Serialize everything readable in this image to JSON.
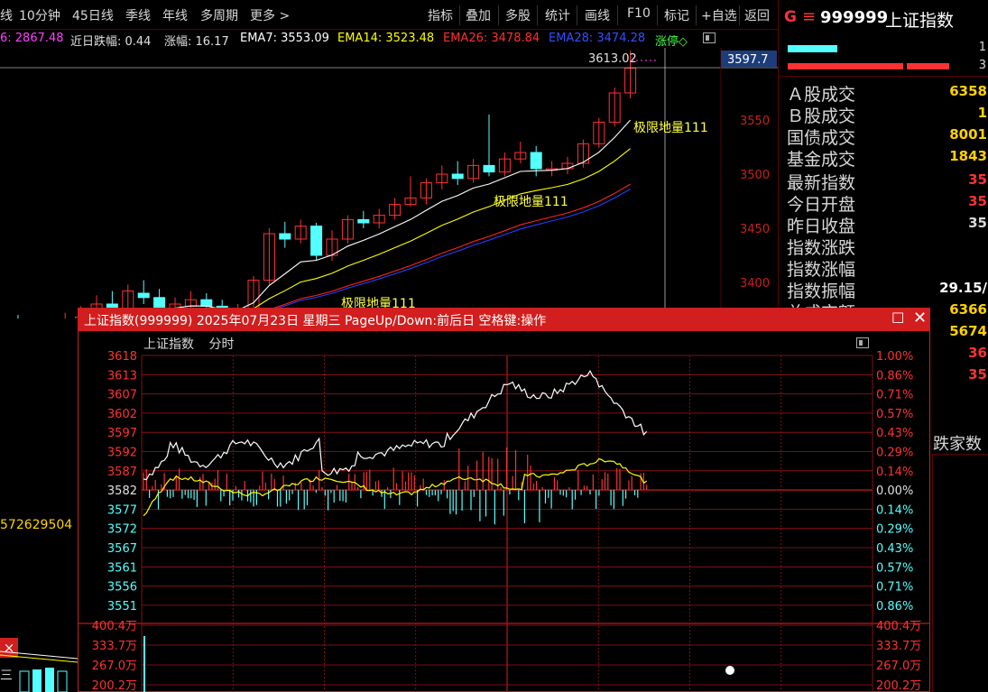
{
  "toolbar": {
    "left_items": [
      "线",
      "10分钟",
      "45日线",
      "季线",
      "年线",
      "多周期",
      "更多 >"
    ],
    "right_items": [
      "指标",
      "叠加",
      "多股",
      "统计",
      "画线",
      "F10",
      "标记",
      "+自选",
      "返回"
    ]
  },
  "indicator_line": {
    "prefix": "6: 2867.48",
    "near_drop_label": "近日跌幅: 0.44",
    "rise_label": "涨幅: 16.17",
    "ema7": "EMA7: 3553.09",
    "ema14": "EMA14: 3523.48",
    "ema26": "EMA26: 3478.84",
    "ema28": "EMA28: 3474.28",
    "limit_up": "涨停◇"
  },
  "kline": {
    "high_label": "3613.02",
    "price_tag": "3597.7",
    "axis_labels": [
      "3550",
      "3500",
      "3450",
      "3400"
    ],
    "annotations": [
      "极限地量111",
      "极限地量111",
      "极限地量111"
    ],
    "colors": {
      "up": "#ff3232",
      "down": "#54ffff",
      "ema7": "#ffffff",
      "ema14": "#ffff00",
      "ema26": "#ff2020",
      "ema28": "#2040ff"
    }
  },
  "right_panel": {
    "logo_text": "G",
    "menu_icon": "≡",
    "code": "999999",
    "name": "上证指数",
    "bar_values": [
      "1",
      "3"
    ],
    "rows": [
      {
        "label": "Ａ股成交",
        "value": "6358"
      },
      {
        "label": "Ｂ股成交",
        "value": "1"
      },
      {
        "label": "国债成交",
        "value": "8001"
      },
      {
        "label": "基金成交",
        "value": "1843"
      },
      {
        "label": "最新指数",
        "value": "35"
      },
      {
        "label": "今日开盘",
        "value": "35"
      },
      {
        "label": "昨日收盘",
        "value": "35"
      },
      {
        "label": "指数涨跌",
        "value": ""
      },
      {
        "label": "指数涨幅",
        "value": ""
      },
      {
        "label": "指数振幅",
        "value": "29.15/"
      },
      {
        "label": "总成交额",
        "value": "6366"
      },
      {
        "label": "",
        "value": "5674"
      },
      {
        "label": "",
        "value": "36"
      },
      {
        "label": "",
        "value": "35"
      }
    ],
    "side_legend": "跌家数"
  },
  "left_fragments": {
    "volume_label": "572629504",
    "close_glyph": "×",
    "char_fragment": "三"
  },
  "popup": {
    "title": "上证指数(999999) 2025年07月23日 星期三 PageUp/Down:前后日 空格键:操作",
    "tab_name": "上证指数",
    "tab_period": "分时",
    "price_ticks": [
      "3618",
      "3613",
      "3607",
      "3602",
      "3597",
      "3592",
      "3587",
      "3582",
      "3577",
      "3572",
      "3567",
      "3561",
      "3556",
      "3551"
    ],
    "pct_ticks": [
      "1.00%",
      "0.86%",
      "0.71%",
      "0.57%",
      "0.43%",
      "0.29%",
      "0.14%",
      "0.00%",
      "0.14%",
      "0.29%",
      "0.43%",
      "0.57%",
      "0.71%",
      "0.86%"
    ],
    "volume_ticks": [
      "400.4万",
      "333.7万",
      "267.0万",
      "200.2万"
    ],
    "base_price": 3582,
    "colors": {
      "price_line": "#ffffff",
      "avg_line": "#ffff00",
      "up_bar": "#ff3232",
      "down_bar": "#54ffff",
      "grid": "#a01414"
    }
  }
}
